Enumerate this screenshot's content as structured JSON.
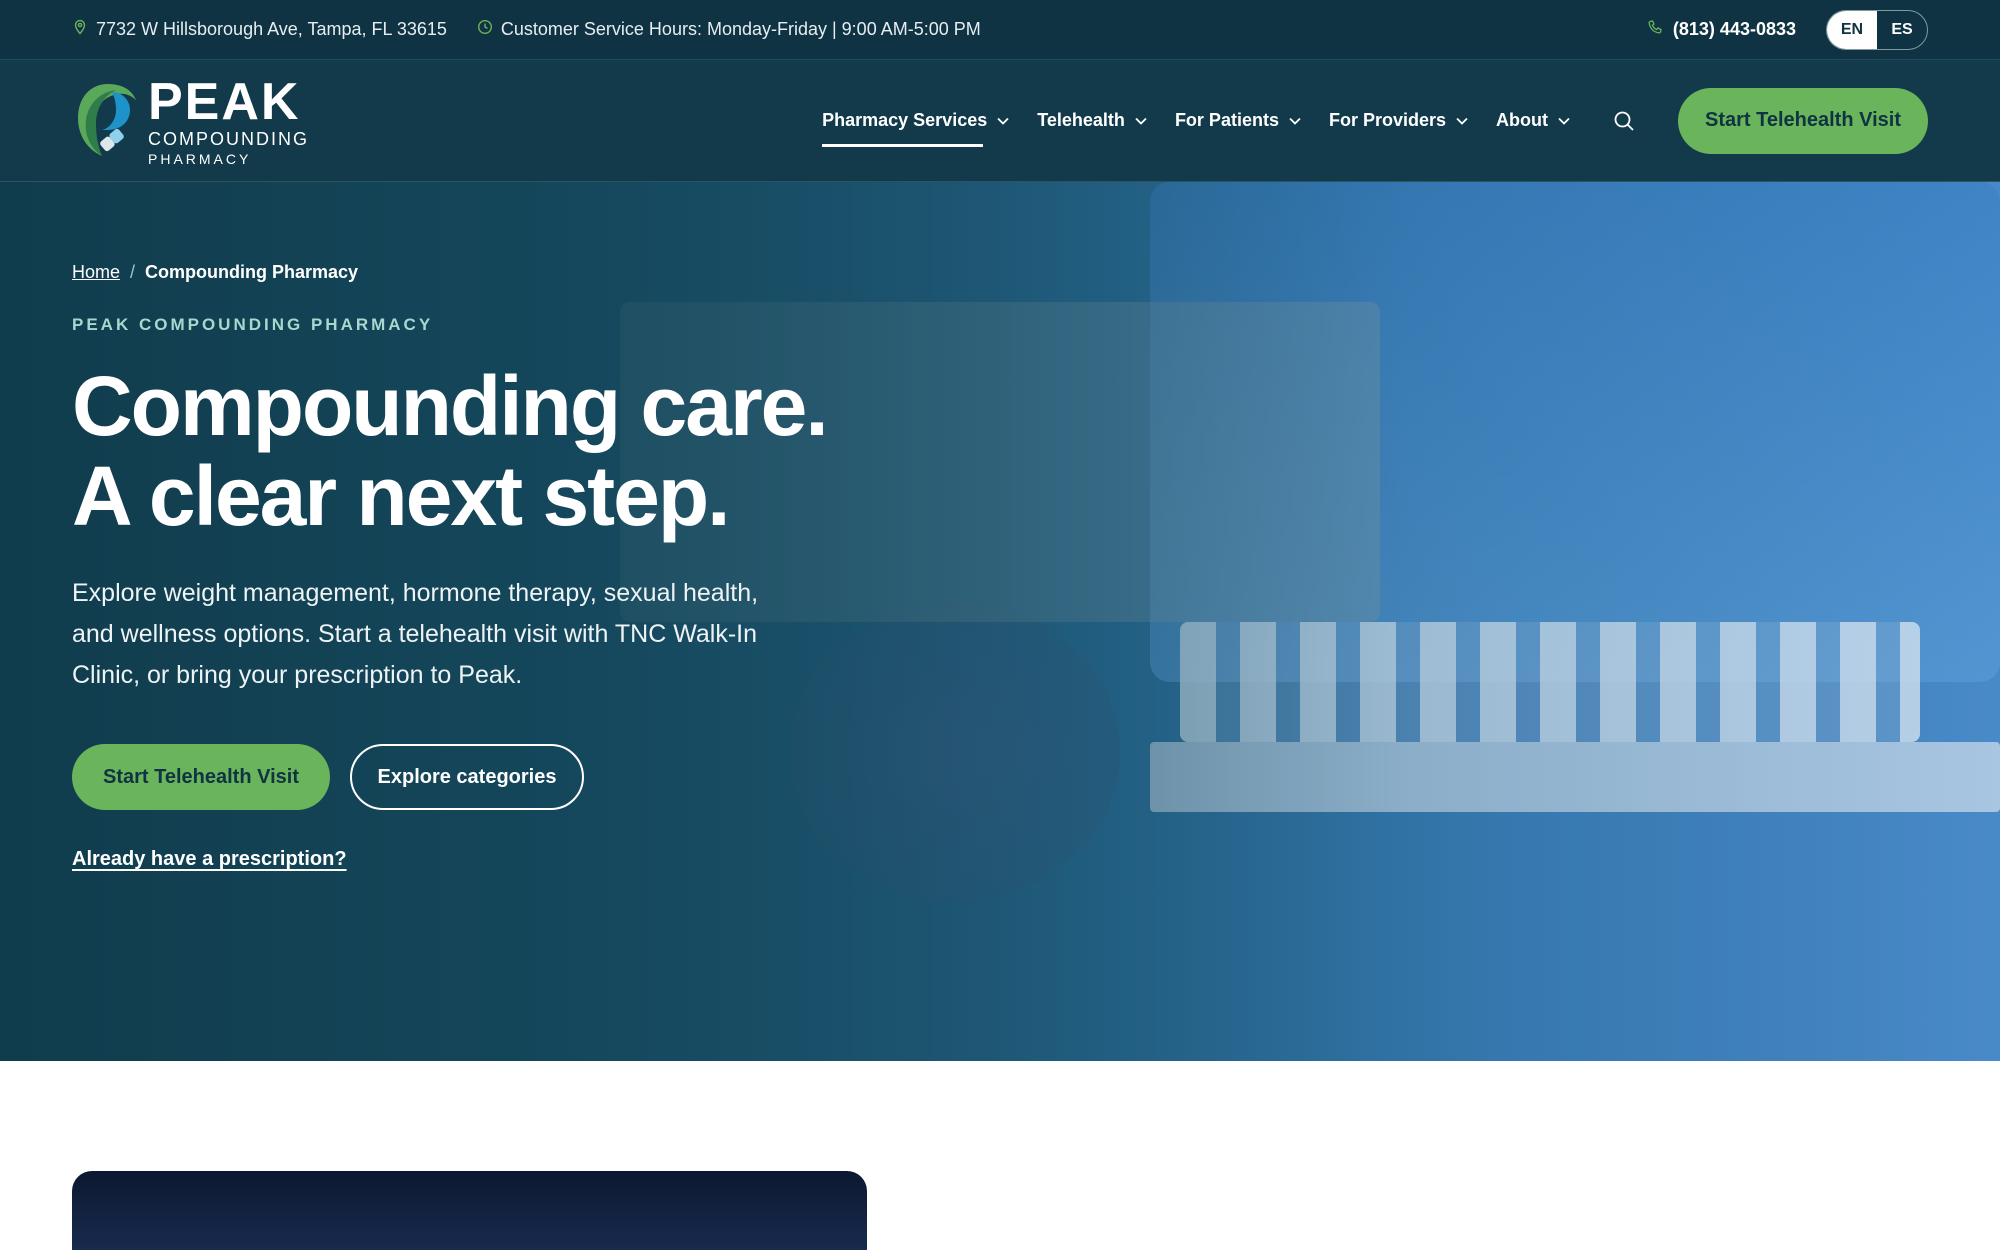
{
  "topbar": {
    "address": "7732 W Hillsborough Ave, Tampa, FL 33615",
    "hours": "Customer Service Hours: Monday-Friday |  9:00 AM-5:00 PM",
    "phone": "(813) 443-0833",
    "lang_en": "EN",
    "lang_es": "ES"
  },
  "logo": {
    "name": "PEAK",
    "line2": "COMPOUNDING",
    "line3": "PHARMACY"
  },
  "nav": {
    "items": [
      {
        "label": "Pharmacy Services"
      },
      {
        "label": "Telehealth"
      },
      {
        "label": "For Patients"
      },
      {
        "label": "For Providers"
      },
      {
        "label": "About"
      }
    ],
    "cta": "Start Telehealth Visit"
  },
  "hero": {
    "breadcrumb_home": "Home",
    "breadcrumb_sep": "/",
    "breadcrumb_current": "Compounding Pharmacy",
    "eyebrow": "PEAK COMPOUNDING PHARMACY",
    "headline_1": "Compounding care.",
    "headline_2": "A clear next step.",
    "lead": "Explore weight management, hormone therapy, sexual health, and wellness options. Start a telehealth visit with TNC Walk-In Clinic, or bring your prescription to Peak.",
    "primary_cta": "Start Telehealth Visit",
    "secondary_cta": "Explore categories",
    "rx_link": "Already have a prescription?"
  },
  "colors": {
    "topbar_bg": "#0f3342",
    "nav_bg": "#123a4b",
    "accent_green": "#6ab45c",
    "eyebrow": "#a9d7cf"
  }
}
